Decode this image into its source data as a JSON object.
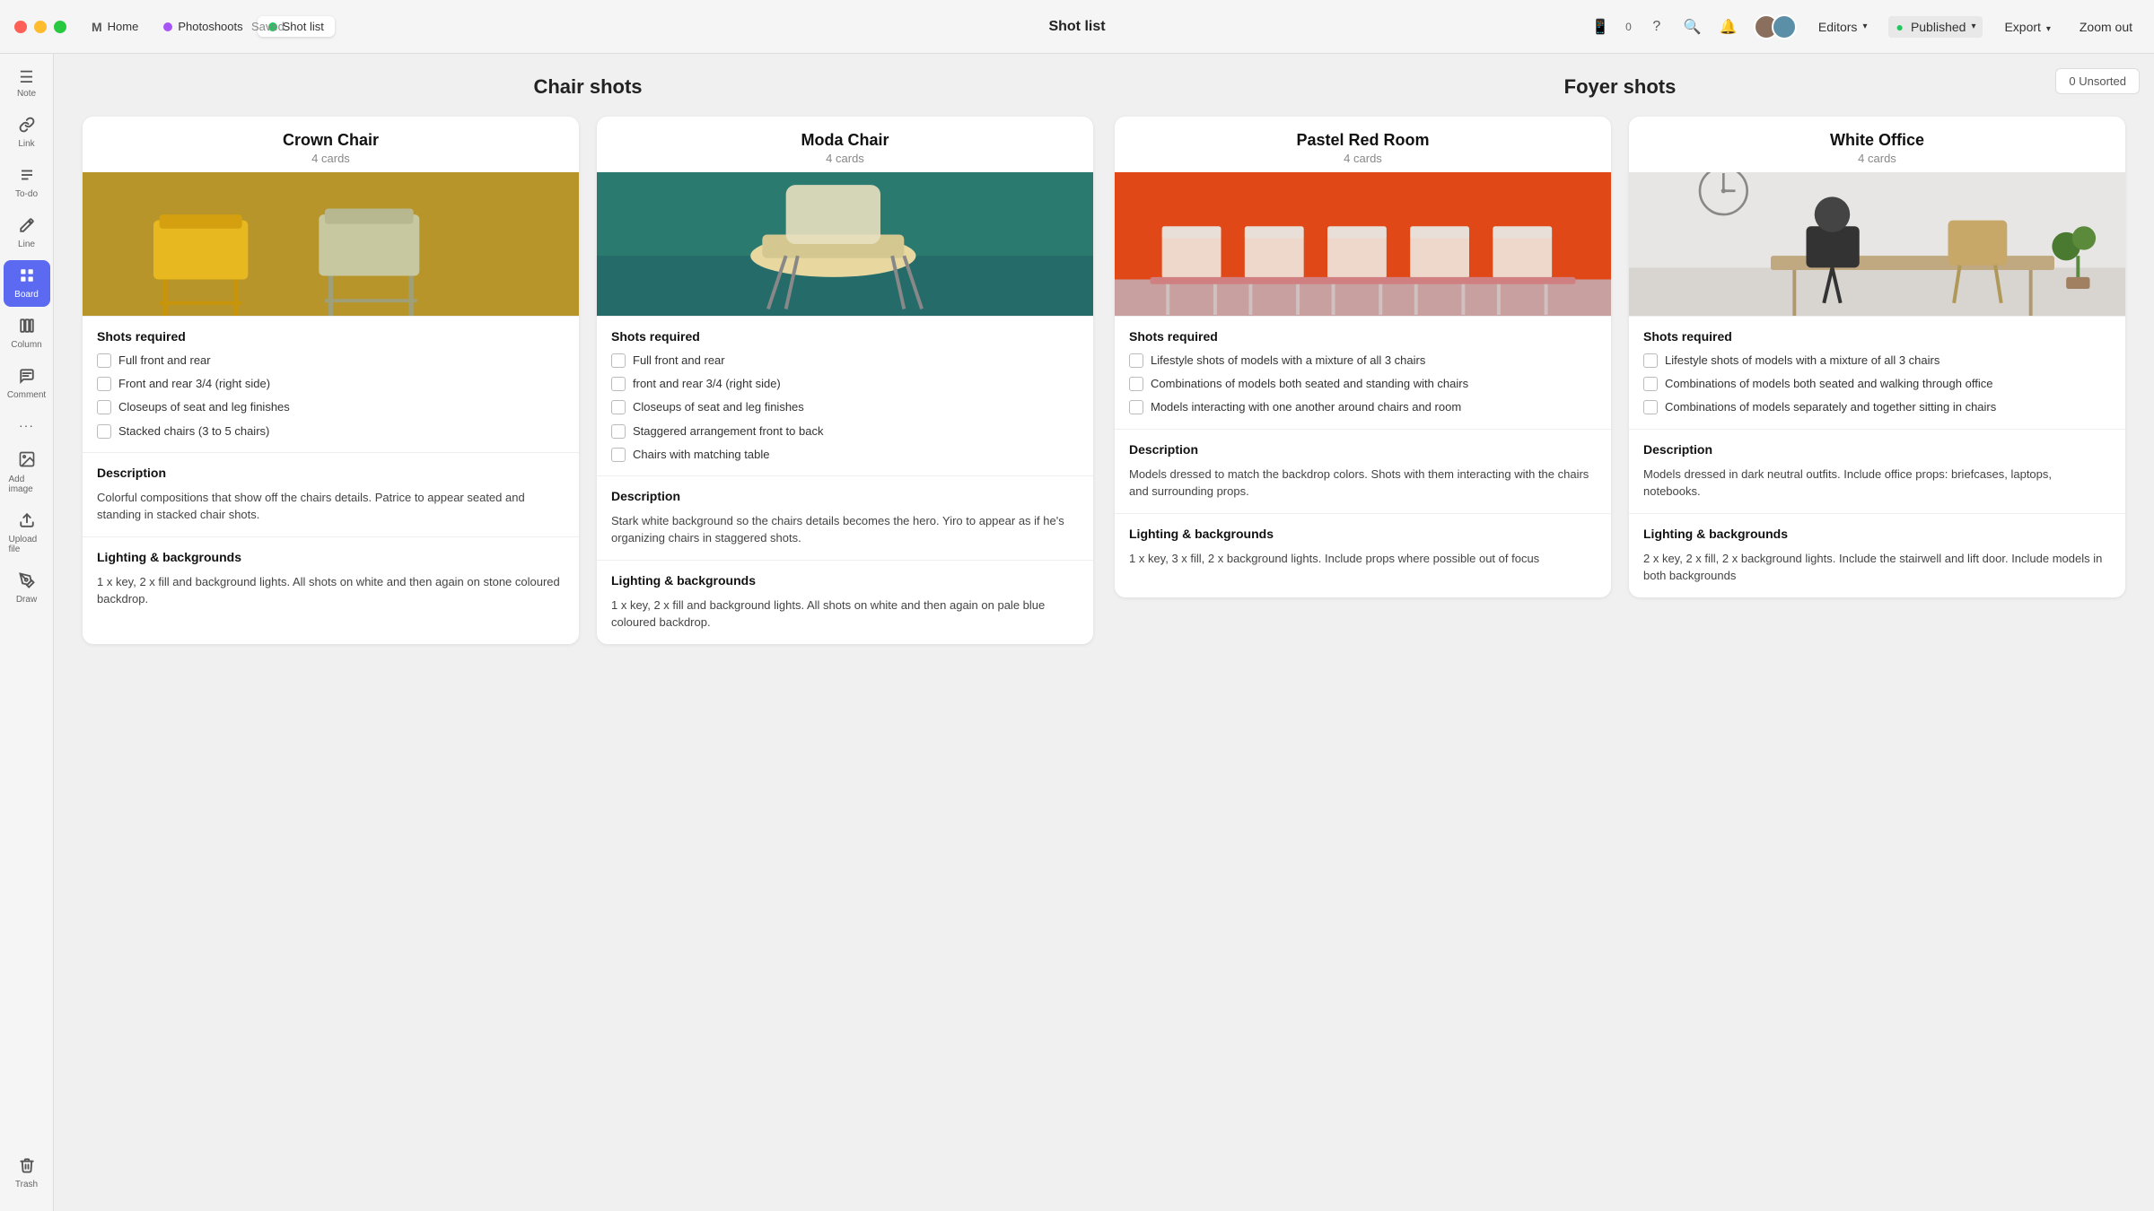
{
  "titlebar": {
    "traffic_lights": [
      "red",
      "yellow",
      "green"
    ],
    "tabs": [
      {
        "id": "home",
        "label": "Home",
        "icon": "M",
        "dot_color": null,
        "active": false
      },
      {
        "id": "photoshoots",
        "label": "Photoshoots",
        "dot_color": "#a855f7",
        "active": false
      },
      {
        "id": "shot-list",
        "label": "Shot list",
        "dot_color": "#22c55e",
        "active": true
      }
    ],
    "saved_label": "Saved",
    "page_title": "Shot list",
    "editors_label": "Editors",
    "published_label": "Published",
    "export_label": "Export",
    "zoom_label": "Zoom out"
  },
  "sidebar": {
    "items": [
      {
        "id": "note",
        "icon": "☰",
        "label": "Note",
        "active": false
      },
      {
        "id": "link",
        "icon": "🔗",
        "label": "Link",
        "active": false
      },
      {
        "id": "todo",
        "icon": "≡",
        "label": "To-do",
        "active": false
      },
      {
        "id": "line",
        "icon": "✏",
        "label": "Line",
        "active": false
      },
      {
        "id": "board",
        "icon": "⊞",
        "label": "Board",
        "active": true
      },
      {
        "id": "column",
        "icon": "▥",
        "label": "Column",
        "active": false
      },
      {
        "id": "comment",
        "icon": "≡",
        "label": "Comment",
        "active": false
      },
      {
        "id": "more",
        "icon": "···",
        "label": "",
        "active": false
      },
      {
        "id": "add-image",
        "icon": "🖼",
        "label": "Add image",
        "active": false
      },
      {
        "id": "upload-file",
        "icon": "⬆",
        "label": "Upload file",
        "active": false
      },
      {
        "id": "draw",
        "icon": "✏",
        "label": "Draw",
        "active": false
      }
    ],
    "trash_label": "Trash"
  },
  "unsorted_label": "0 Unsorted",
  "sections": [
    {
      "id": "chair-shots",
      "title": "Chair shots",
      "cards": [
        {
          "id": "crown-chair",
          "title": "Crown Chair",
          "cards_count": "4 cards",
          "image_color": "#c8a010",
          "image_type": "crown",
          "shots_required_title": "Shots required",
          "shots": [
            "Full front and rear",
            "Front and rear 3/4 (right side)",
            "Closeups of seat and leg finishes",
            "Stacked chairs (3 to 5 chairs)"
          ],
          "description_title": "Description",
          "description": "Colorful compositions that show off the chairs details. Patrice to appear seated and standing in stacked chair shots.",
          "lighting_title": "Lighting & backgrounds",
          "lighting": "1 x key, 2 x fill and background lights. All shots on white and then again on stone coloured backdrop."
        },
        {
          "id": "moda-chair",
          "title": "Moda Chair",
          "cards_count": "4 cards",
          "image_color": "#2a7a6a",
          "image_type": "moda",
          "shots_required_title": "Shots required",
          "shots": [
            "Full front and rear",
            "front and rear 3/4 (right side)",
            "Closeups of seat and leg finishes",
            "Staggered arrangement front to back",
            "Chairs with matching table"
          ],
          "description_title": "Description",
          "description": "Stark white background so the chairs details becomes the hero. Yiro to appear as if he's organizing chairs in staggered shots.",
          "lighting_title": "Lighting & backgrounds",
          "lighting": "1 x key, 2 x fill and background lights. All shots on white and then again on pale blue coloured backdrop."
        }
      ]
    },
    {
      "id": "foyer-shots",
      "title": "Foyer shots",
      "cards": [
        {
          "id": "pastel-red-room",
          "title": "Pastel Red Room",
          "cards_count": "4 cards",
          "image_color": "#e05020",
          "image_type": "pastel",
          "shots_required_title": "Shots required",
          "shots": [
            "Lifestyle shots of models with a mixture of all 3 chairs",
            "Combinations of models both seated and standing with chairs",
            "Models interacting with one another around chairs and room"
          ],
          "description_title": "Description",
          "description": "Models dressed to match the backdrop colors. Shots with them interacting with the chairs and surrounding props.",
          "lighting_title": "Lighting & backgrounds",
          "lighting": "1 x key, 3 x fill, 2 x background lights. Include props where possible out of focus"
        },
        {
          "id": "white-office",
          "title": "White Office",
          "cards_count": "4 cards",
          "image_color": "#e8e4e0",
          "image_type": "white",
          "shots_required_title": "Shots required",
          "shots": [
            "Lifestyle shots of models with a mixture of all 3 chairs",
            "Combinations of models both seated and walking through office",
            "Combinations of models separately and together sitting in chairs"
          ],
          "description_title": "Description",
          "description": "Models dressed in dark neutral outfits. Include office props: briefcases, laptops, notebooks.",
          "lighting_title": "Lighting & backgrounds",
          "lighting": "2 x key, 2 x fill, 2 x background lights. Include the stairwell and lift door. Include models in both backgrounds"
        }
      ]
    }
  ]
}
